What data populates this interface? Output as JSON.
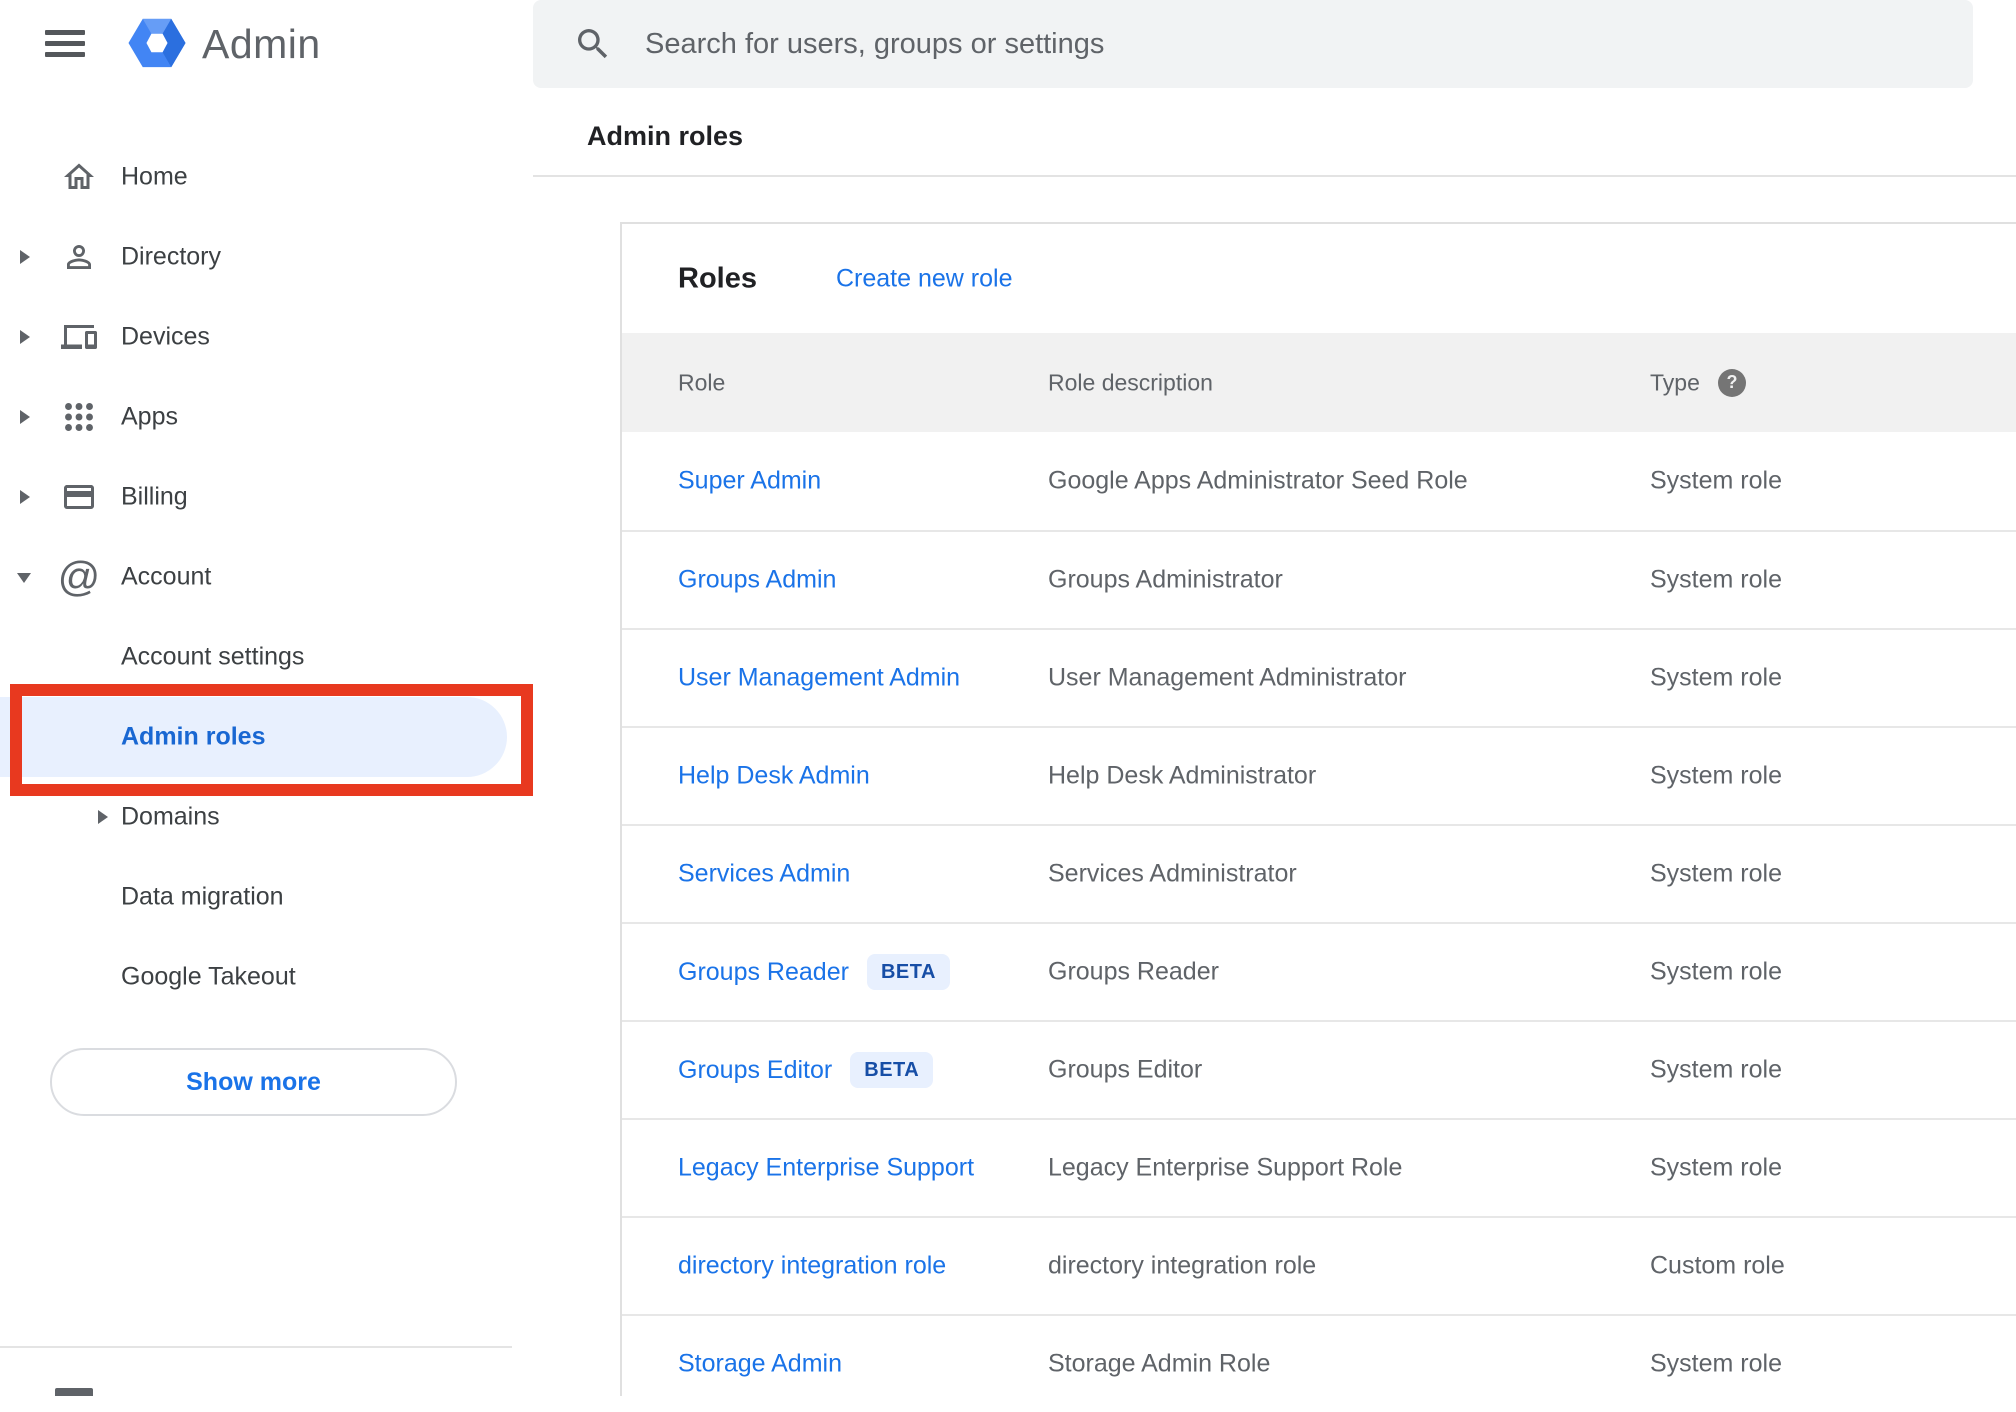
{
  "app": {
    "name": "Admin"
  },
  "search": {
    "placeholder": "Search for users, groups or settings"
  },
  "page": {
    "title": "Admin roles"
  },
  "sidebar": {
    "items": [
      {
        "label": "Home",
        "icon": "home-icon",
        "expand": "none"
      },
      {
        "label": "Directory",
        "icon": "person-icon",
        "expand": "right"
      },
      {
        "label": "Devices",
        "icon": "devices-icon",
        "expand": "right"
      },
      {
        "label": "Apps",
        "icon": "apps-grid-icon",
        "expand": "right"
      },
      {
        "label": "Billing",
        "icon": "credit-card-icon",
        "expand": "right"
      },
      {
        "label": "Account",
        "icon": "at-sign-icon",
        "expand": "down"
      }
    ],
    "sub_items": [
      {
        "label": "Account settings",
        "selected": false
      },
      {
        "label": "Admin roles",
        "selected": true
      },
      {
        "label": "Domains",
        "selected": false,
        "expand": "right"
      },
      {
        "label": "Data migration",
        "selected": false
      },
      {
        "label": "Google Takeout",
        "selected": false
      }
    ],
    "show_more_label": "Show more"
  },
  "roles_card": {
    "title": "Roles",
    "create_link": "Create new role",
    "columns": [
      "Role",
      "Role description",
      "Type"
    ],
    "help_glyph": "?",
    "rows": [
      {
        "role": "Super Admin",
        "badge": "",
        "description": "Google Apps Administrator Seed Role",
        "type": "System role"
      },
      {
        "role": "Groups Admin",
        "badge": "",
        "description": "Groups Administrator",
        "type": "System role"
      },
      {
        "role": "User Management Admin",
        "badge": "",
        "description": "User Management Administrator",
        "type": "System role"
      },
      {
        "role": "Help Desk Admin",
        "badge": "",
        "description": "Help Desk Administrator",
        "type": "System role"
      },
      {
        "role": "Services Admin",
        "badge": "",
        "description": "Services Administrator",
        "type": "System role"
      },
      {
        "role": "Groups Reader",
        "badge": "BETA",
        "description": "Groups Reader",
        "type": "System role"
      },
      {
        "role": "Groups Editor",
        "badge": "BETA",
        "description": "Groups Editor",
        "type": "System role"
      },
      {
        "role": "Legacy Enterprise Support",
        "badge": "",
        "description": "Legacy Enterprise Support Role",
        "type": "System role"
      },
      {
        "role": "directory integration role",
        "badge": "",
        "description": "directory integration role",
        "type": "Custom role"
      },
      {
        "role": "Storage Admin",
        "badge": "",
        "description": "Storage Admin Role",
        "type": "System role"
      }
    ]
  },
  "colors": {
    "link_blue": "#1a73e8",
    "selected_blue": "#1967d2",
    "selected_pill_bg": "#e8f0fe",
    "beta_badge_bg": "#e8f0fe",
    "beta_badge_text": "#174ea6",
    "annotation_red": "#e8391f",
    "logo_blue": "#4285f4",
    "icon_gray": "#5f6368",
    "table_header_bg": "#f1f1f1",
    "search_bg": "#f1f3f4"
  }
}
